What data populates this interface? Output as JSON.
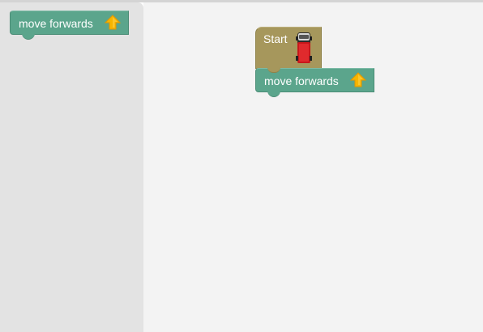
{
  "toolbox": {
    "blocks": [
      {
        "label": "move forwards",
        "icon": "up-arrow-icon"
      }
    ]
  },
  "workspace": {
    "start_block": {
      "label": "Start",
      "icon": "car-icon"
    },
    "program": [
      {
        "label": "move forwards",
        "icon": "up-arrow-icon"
      }
    ]
  },
  "colors": {
    "move_block": "#5ba58c",
    "start_block": "#a6975c",
    "toolbox_bg": "#e3e3e3",
    "workspace_bg": "#f3f3f3",
    "arrow": "#f7b500",
    "car": "#c8171b"
  }
}
